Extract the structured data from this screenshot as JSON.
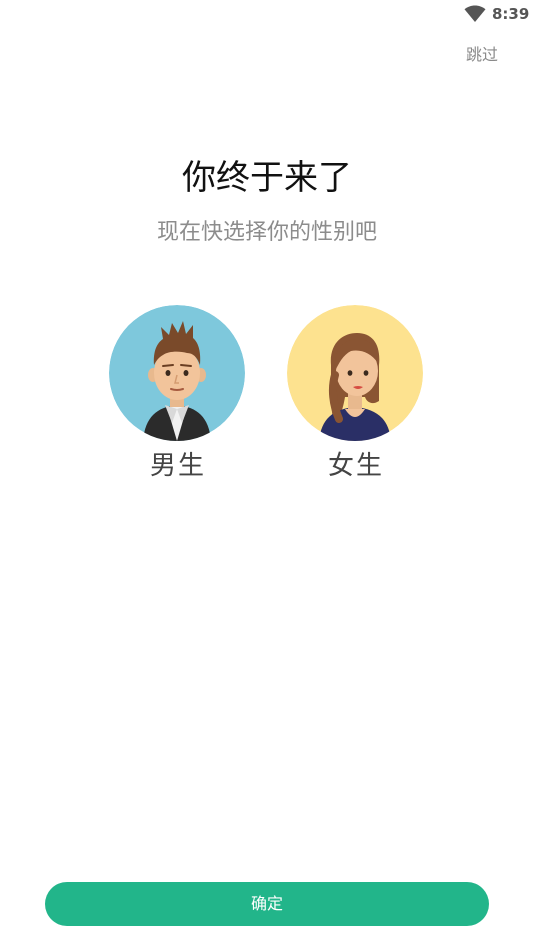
{
  "status_bar": {
    "time": "8:39",
    "icons": [
      "wifi-icon"
    ]
  },
  "header": {
    "skip_label": "跳过"
  },
  "main": {
    "title": "你终于来了",
    "subtitle": "现在快选择你的性别吧",
    "options": [
      {
        "label": "男生",
        "avatar": "male-avatar",
        "avatar_bg": "#7ec8dc"
      },
      {
        "label": "女生",
        "avatar": "female-avatar",
        "avatar_bg": "#fde28f"
      }
    ]
  },
  "footer": {
    "confirm_label": "确定",
    "accent_color": "#22b58a"
  }
}
